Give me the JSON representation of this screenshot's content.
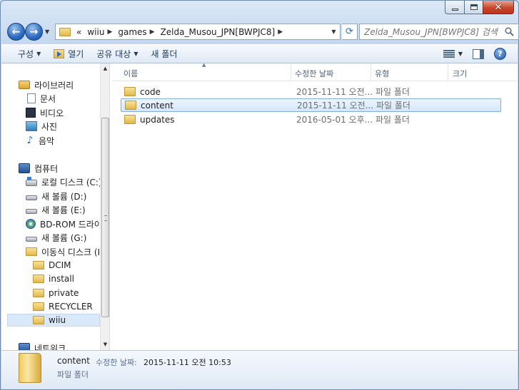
{
  "breadcrumb": [
    "«",
    "wiiu",
    "games",
    "Zelda_Musou_JPN[BWPJC8]"
  ],
  "search": {
    "placeholder": "Zelda_Musou_JPN[BWPJC8] 검색"
  },
  "commands": {
    "organize": "구성",
    "open": "열기",
    "share": "공유 대상",
    "new_folder": "새 폴더"
  },
  "navigation": {
    "libraries": "라이브러리",
    "documents": "문서",
    "videos": "비디오",
    "pictures": "사진",
    "music": "음악",
    "computer": "컴퓨터",
    "local_disk": "로컬 디스크 (C:)",
    "vol_d": "새 볼륨 (D:)",
    "vol_e": "새 볼륨 (E:)",
    "bd_rom": "BD-ROM 드라이",
    "vol_g": "새 볼륨 (G:)",
    "removable": "이동식 디스크 (I:",
    "dcim": "DCIM",
    "install": "install",
    "private": "private",
    "recycler": "RECYCLER",
    "wiiu": "wiiu",
    "network": "네트워크"
  },
  "columns": {
    "name": "이름",
    "modified": "수정한 날짜",
    "type": "유형",
    "size": "크기"
  },
  "files": [
    {
      "name": "code",
      "modified": "2015-11-11 오전...",
      "type": "파일 폴더"
    },
    {
      "name": "content",
      "modified": "2015-11-11 오전...",
      "type": "파일 폴더"
    },
    {
      "name": "updates",
      "modified": "2016-05-01 오후...",
      "type": "파일 폴더"
    }
  ],
  "details": {
    "name": "content",
    "modified_label": "수정한 날짜:",
    "modified_value": "2015-11-11 오전 10:53",
    "type": "파일 폴더"
  },
  "colors": {
    "selection": "#d4e7fb",
    "selection_border": "#84acdd",
    "title_bg": "#c3d8f0"
  }
}
